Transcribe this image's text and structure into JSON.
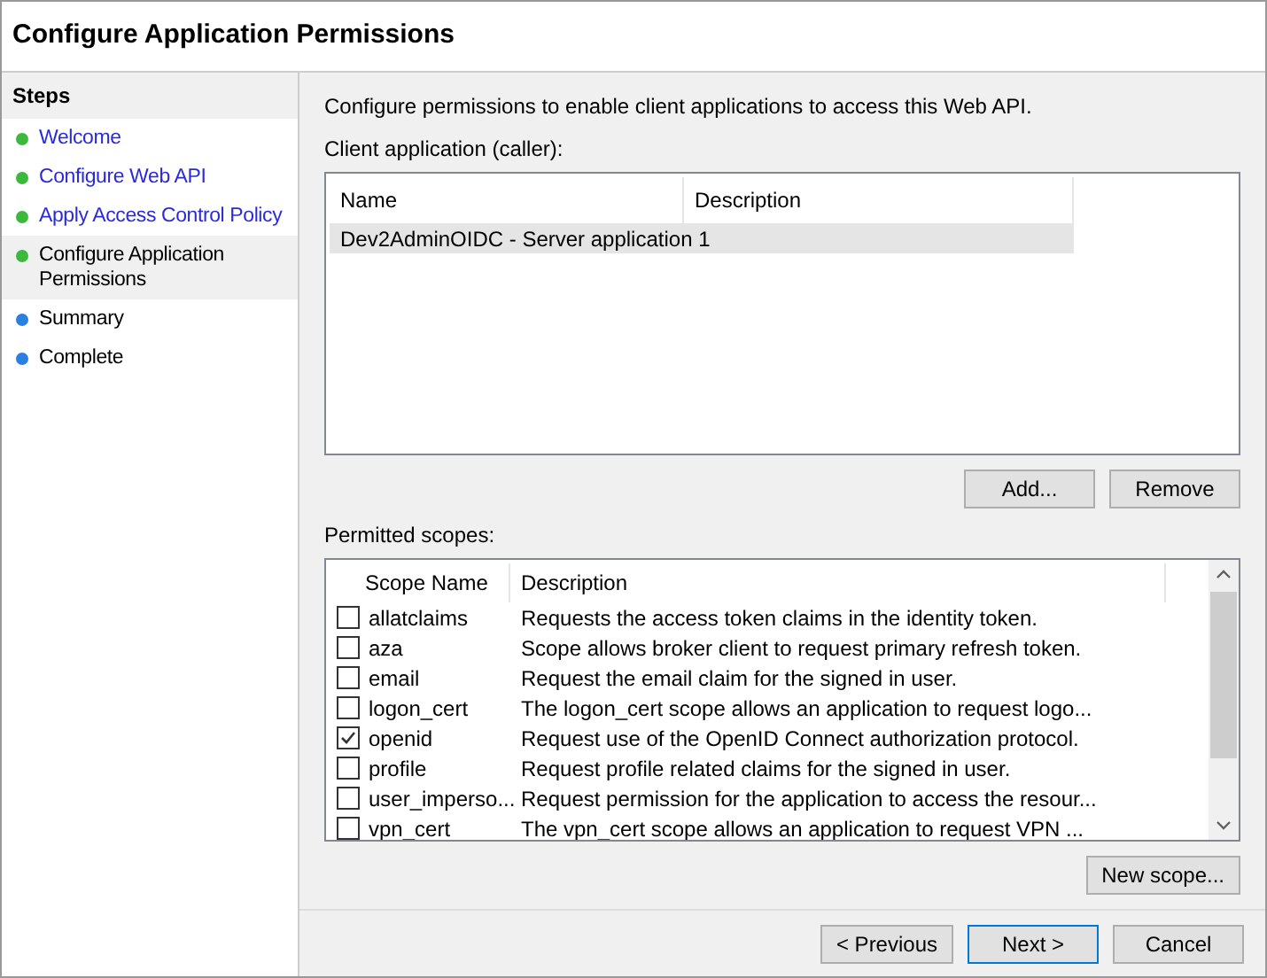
{
  "window": {
    "title": "Configure Application Permissions"
  },
  "steps": {
    "heading": "Steps",
    "items": [
      {
        "label": "Welcome",
        "kind": "done",
        "selected": false
      },
      {
        "label": "Configure Web API",
        "kind": "done",
        "selected": false
      },
      {
        "label": "Apply Access Control Policy",
        "kind": "done",
        "selected": false
      },
      {
        "label": "Configure Application Permissions",
        "kind": "done",
        "selected": true
      },
      {
        "label": "Summary",
        "kind": "pending",
        "selected": false
      },
      {
        "label": "Complete",
        "kind": "pending",
        "selected": false
      }
    ]
  },
  "intro": "Configure permissions to enable client applications to access this Web API.",
  "clients": {
    "label": "Client application (caller):",
    "columns": [
      "Name",
      "Description"
    ],
    "rows": [
      {
        "name": "Dev2AdminOIDC - Server application 1",
        "description": "",
        "selected": true
      }
    ]
  },
  "client_buttons": [
    "Add...",
    "Remove"
  ],
  "scopes": {
    "label": "Permitted scopes:",
    "columns": [
      "Scope Name",
      "Description"
    ],
    "rows": [
      {
        "name": "allatclaims",
        "description": "Requests the access token claims in the identity token.",
        "checked": false
      },
      {
        "name": "aza",
        "description": "Scope allows broker client to request primary refresh token.",
        "checked": false
      },
      {
        "name": "email",
        "description": "Request the email claim for the signed in user.",
        "checked": false
      },
      {
        "name": "logon_cert",
        "description": "The logon_cert scope allows an application to request logo...",
        "checked": false
      },
      {
        "name": "openid",
        "description": "Request use of the OpenID Connect authorization protocol.",
        "checked": true
      },
      {
        "name": "profile",
        "description": "Request profile related claims for the signed in user.",
        "checked": false
      },
      {
        "name": "user_imperso...",
        "description": "Request permission for the application to access the resour...",
        "checked": false
      },
      {
        "name": "vpn_cert",
        "description": "The vpn_cert scope allows an application to request VPN ...",
        "checked": false
      }
    ]
  },
  "scope_button": "New scope...",
  "nav_buttons": [
    "< Previous",
    "Next >",
    "Cancel"
  ]
}
